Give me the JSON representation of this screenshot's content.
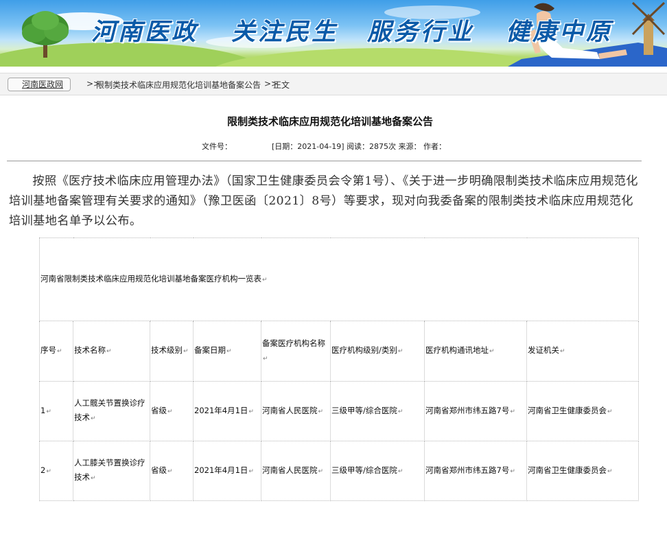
{
  "banner": {
    "slogans": [
      "河南医政",
      "关注民生",
      "服务行业",
      "健康中原"
    ]
  },
  "breadcrumb": {
    "home": "河南医政网",
    "separator": ">>",
    "category": "限制类技术临床应用规范化培训基地备案公告",
    "current": "正文"
  },
  "article": {
    "title": "限制类技术临床应用规范化培训基地备案公告",
    "meta": {
      "doc_no_label": "文件号：",
      "date_label": "[日期：",
      "date": "2021-04-19",
      "reads_label": "] 阅读：",
      "reads": "2875",
      "reads_unit": "次",
      "source_label": "来源：",
      "author_label": "作者："
    },
    "paragraph": "按照《医疗技术临床应用管理办法》（国家卫生健康委员会令第1号）、《关于进一步明确限制类技术临床应用规范化培训基地备案管理有关要求的通知》（豫卫医函〔2021〕8号）等要求，现对向我委备案的限制类技术临床应用规范化培训基地名单予以公布。"
  },
  "table": {
    "caption": "河南省限制类技术临床应用规范化培训基地备案医疗机构一览表",
    "cell_mark": "↵",
    "headers": [
      "序号",
      "技术名称",
      "技术级别",
      "备案日期",
      "备案医疗机构名称",
      "医疗机构级别/类别",
      "医疗机构通讯地址",
      "发证机关"
    ],
    "rows": [
      [
        "1",
        "人工髋关节置换诊疗技术",
        "省级",
        "2021年4月1日",
        "河南省人民医院",
        "三级甲等/综合医院",
        "河南省郑州市纬五路7号",
        "河南省卫生健康委员会"
      ],
      [
        "2",
        "人工膝关节置换诊疗技术",
        "省级",
        "2021年4月1日",
        "河南省人民医院",
        "三级甲等/综合医院",
        "河南省郑州市纬五路7号",
        "河南省卫生健康委员会"
      ]
    ]
  }
}
